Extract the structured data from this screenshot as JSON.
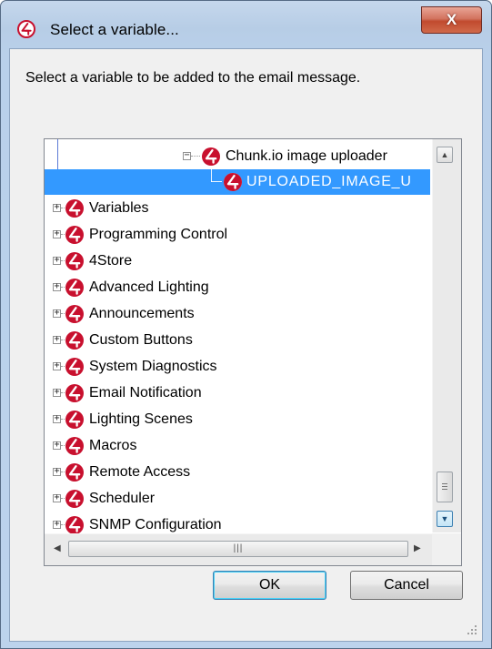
{
  "dialog": {
    "title": "Select a variable...",
    "close_label": "X",
    "instruction": "Select a variable to be added to the email message."
  },
  "tree": {
    "partial_top_item": "Chunk.io image uploader",
    "selected_item": "UPLOADED_IMAGE_U",
    "items": [
      "Variables",
      "Programming Control",
      "4Store",
      "Advanced Lighting",
      "Announcements",
      "Custom Buttons",
      "System Diagnostics",
      "Email Notification",
      "Lighting Scenes",
      "Macros",
      "Remote Access",
      "Scheduler",
      "SNMP Configuration"
    ]
  },
  "buttons": {
    "ok": "OK",
    "cancel": "Cancel"
  },
  "icons": {
    "node_icon": "control4-logo-icon",
    "expand_icon": "plus-expander-icon",
    "collapse_icon": "minus-expander-icon"
  },
  "colors": {
    "selection": "#3399ff",
    "icon_red": "#c8102e",
    "close_button": "#c14a2e"
  }
}
